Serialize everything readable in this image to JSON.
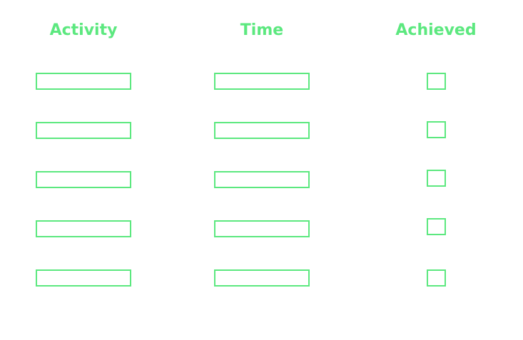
{
  "columns": {
    "activity": "Activity",
    "time": "Time",
    "achieved": "Achieved"
  },
  "rows": [
    {
      "activity": "",
      "time": "",
      "achieved": false
    },
    {
      "activity": "",
      "time": "",
      "achieved": false
    },
    {
      "activity": "",
      "time": "",
      "achieved": false
    },
    {
      "activity": "",
      "time": "",
      "achieved": false
    },
    {
      "activity": "",
      "time": "",
      "achieved": false
    }
  ],
  "colors": {
    "accent": "#5ce87f",
    "background": "#ffffff"
  }
}
